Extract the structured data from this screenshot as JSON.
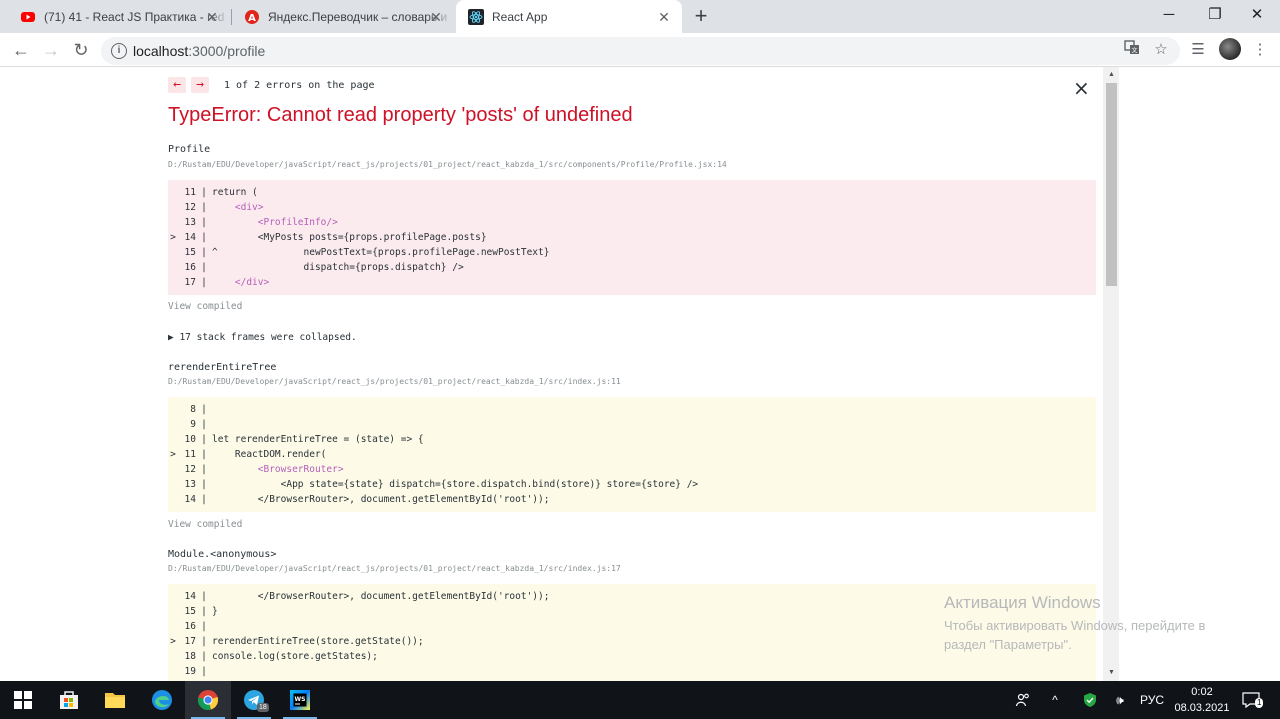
{
  "browser": {
    "tabs": [
      {
        "title": "(71) 41 - React JS Практика - red",
        "icon": "youtube-icon"
      },
      {
        "title": "Яндекс.Переводчик – словарь и",
        "icon": "yandex-translate-icon"
      },
      {
        "title": "React App",
        "icon": "react-icon"
      }
    ],
    "new_tab_label": "+",
    "url_host": "localhost",
    "url_path": ":3000/profile"
  },
  "overlay": {
    "prev_label": "←",
    "next_label": "→",
    "counter": "1 of 2 errors on the page",
    "close_label": "×",
    "error_title": "TypeError: Cannot read property 'posts' of undefined",
    "view_compiled": "View compiled",
    "collapsed_text": "▶ 17 stack frames were collapsed.",
    "frames": [
      {
        "name": "Profile",
        "path": "D:/Rustam/EDU/Developer/javaScript/react_js/projects/01_project/react_kabzda_1/src/components/Profile/Profile.jsx:14",
        "lines": [
          {
            "mark": "",
            "num": "11",
            "code": "return ("
          },
          {
            "mark": "",
            "num": "12",
            "code": "    <div>"
          },
          {
            "mark": "",
            "num": "13",
            "code": "        <ProfileInfo/>"
          },
          {
            "mark": ">",
            "num": "14",
            "code": "        <MyPosts posts={props.profilePage.posts}"
          },
          {
            "mark": "",
            "num": "15",
            "code": "^               newPostText={props.profilePage.newPostText}"
          },
          {
            "mark": "",
            "num": "16",
            "code": "                dispatch={props.dispatch} />"
          },
          {
            "mark": "",
            "num": "17",
            "code": "    </div>"
          }
        ]
      },
      {
        "name": "rerenderEntireTree",
        "path": "D:/Rustam/EDU/Developer/javaScript/react_js/projects/01_project/react_kabzda_1/src/index.js:11",
        "lines": [
          {
            "mark": "",
            "num": "8",
            "code": ""
          },
          {
            "mark": "",
            "num": "9",
            "code": ""
          },
          {
            "mark": "",
            "num": "10",
            "code": "let rerenderEntireTree = (state) => {"
          },
          {
            "mark": ">",
            "num": "11",
            "code": "    ReactDOM.render("
          },
          {
            "mark": "",
            "num": "12",
            "code": "        <BrowserRouter>"
          },
          {
            "mark": "",
            "num": "13",
            "code": "            <App state={state} dispatch={store.dispatch.bind(store)} store={store} />"
          },
          {
            "mark": "",
            "num": "14",
            "code": "        </BrowserRouter>, document.getElementById('root'));"
          }
        ]
      },
      {
        "name": "Module.<anonymous>",
        "path": "D:/Rustam/EDU/Developer/javaScript/react_js/projects/01_project/react_kabzda_1/src/index.js:17",
        "lines": [
          {
            "mark": "",
            "num": "14",
            "code": "        </BrowserRouter>, document.getElementById('root'));"
          },
          {
            "mark": "",
            "num": "15",
            "code": "}"
          },
          {
            "mark": "",
            "num": "16",
            "code": ""
          },
          {
            "mark": ">",
            "num": "17",
            "code": "rerenderEntireTree(store.getState());"
          },
          {
            "mark": "",
            "num": "18",
            "code": "console.log(store.getStates);"
          },
          {
            "mark": "",
            "num": "19",
            "code": ""
          }
        ]
      }
    ]
  },
  "watermark": {
    "title": "Активация Windows",
    "text": "Чтобы активировать Windows, перейдите в раздел \"Параметры\"."
  },
  "taskbar": {
    "lang": "РУС",
    "time": "0:02",
    "date": "08.03.2021",
    "telegram_badge": "18",
    "notif_count": "1"
  },
  "colors": {
    "error_red": "#ce1126",
    "frame_bg_error": "#fcebee",
    "frame_bg_other": "#fdfbe8"
  }
}
